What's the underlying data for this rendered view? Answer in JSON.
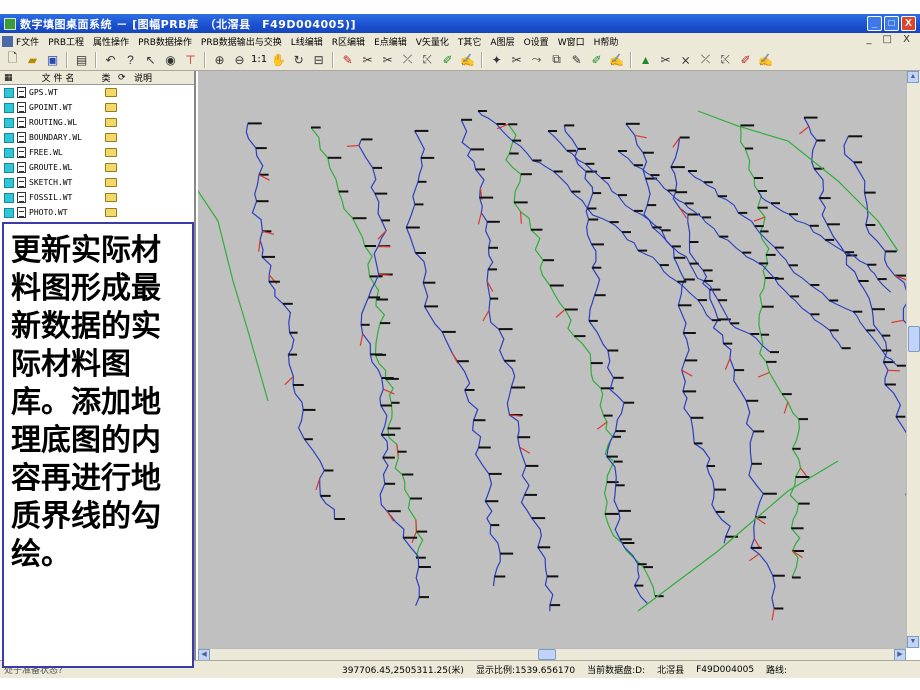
{
  "window": {
    "title": "数字填图桌面系统 － [图幅PRB库　（北滘县　F49D004005)]",
    "buttons": {
      "minimize": "_",
      "maximize": "□",
      "close": "X"
    }
  },
  "menu": {
    "items": [
      "F文件",
      "PRB工程",
      "属性操作",
      "PRB数据操作",
      "PRB数据输出与交换",
      "L线编辑",
      "R区编辑",
      "E点编辑",
      "V矢量化",
      "T其它",
      "A图层",
      "O设置",
      "W窗口",
      "H帮助"
    ],
    "mdi_controls": "_ □ X"
  },
  "toolbar": {
    "zoom_label": "1:1"
  },
  "file_panel": {
    "header": {
      "col_file": "文 件 名",
      "col_type": "类",
      "col_desc": "说明"
    },
    "files": [
      {
        "name": "GPS.WT"
      },
      {
        "name": "GPOINT.WT"
      },
      {
        "name": "ROUTING.WL"
      },
      {
        "name": "BOUNDARY.WL"
      },
      {
        "name": "FREE.WL"
      },
      {
        "name": "GROUTE.WL"
      },
      {
        "name": "SKETCH.WT"
      },
      {
        "name": "FOSSIL.WT"
      },
      {
        "name": "PHOTO.WT"
      }
    ]
  },
  "caption": "更新实际材料图形成最新数据的实际材料图库。添加地理底图的内容再进行地质界线的勾绘。",
  "colors": {
    "title_bar": "#1a4fcf",
    "map_background": "#c0c0c0",
    "route_blue": "#2a3fbf",
    "boundary_green": "#2fae3a",
    "attitude_red": "#d83a2a",
    "caption_border": "#3a3aa8"
  },
  "statusbar": {
    "ready": "处于准备状态?",
    "coordinates": "397706.45,2505311.25(米)",
    "scale": "显示比例:1539.656170",
    "current_db": "当前数据盘:D:",
    "county": "北滘县",
    "sheet": "F49D004005",
    "route_label": "路线:"
  }
}
